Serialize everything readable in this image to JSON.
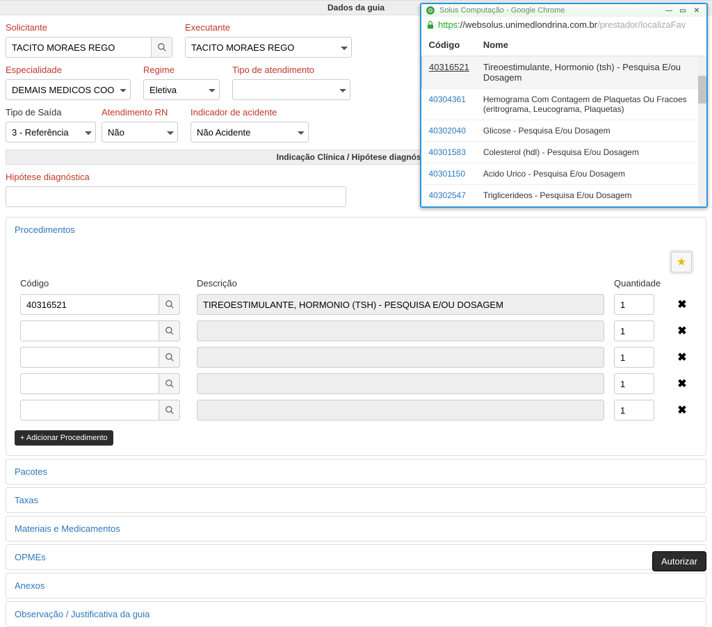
{
  "section1_title": "Dados da guia",
  "fields": {
    "solicitante": {
      "label": "Solicitante",
      "value": "TACITO MORAES REGO"
    },
    "executante": {
      "label": "Executante",
      "value": "TACITO MORAES REGO"
    },
    "especialidade": {
      "label": "Especialidade",
      "value": "DEMAIS MEDICOS COOP"
    },
    "regime": {
      "label": "Regime",
      "value": "Eletiva"
    },
    "tipo_atendimento": {
      "label": "Tipo de atendimento",
      "value": ""
    },
    "tipo_saida": {
      "label": "Tipo de Saída",
      "value": "3 - Referência"
    },
    "atend_rn": {
      "label": "Atendimento RN",
      "value": "Não"
    },
    "ind_acidente": {
      "label": "Indicador de acidente",
      "value": "Não Acidente"
    }
  },
  "section2_title": "Indicação Clínica / Hipótese diagnóstica",
  "hipotese_label": "Hipótese diagnóstica",
  "hipotese_value": "",
  "procedimentos": {
    "tab_label": "Procedimentos",
    "cols": {
      "codigo": "Código",
      "descricao": "Descrição",
      "quantidade": "Quantidade"
    },
    "rows": [
      {
        "codigo": "40316521",
        "descricao": "TIREOESTIMULANTE, HORMONIO (TSH) - PESQUISA E/OU DOSAGEM",
        "quantidade": "1"
      },
      {
        "codigo": "",
        "descricao": "",
        "quantidade": "1"
      },
      {
        "codigo": "",
        "descricao": "",
        "quantidade": "1"
      },
      {
        "codigo": "",
        "descricao": "",
        "quantidade": "1"
      },
      {
        "codigo": "",
        "descricao": "",
        "quantidade": "1"
      }
    ],
    "add_btn": "+ Adicionar Procedimento"
  },
  "accordions": {
    "pacotes": "Pacotes",
    "taxas": "Taxas",
    "materiais": "Materiais e Medicamentos",
    "opmes": "OPMEs",
    "anexos": "Anexos",
    "obs": "Observação / Justificativa da guia"
  },
  "authorize_btn": "Autorizar",
  "popup": {
    "title": "Solus Computação - Google Chrome",
    "url_scheme": "https",
    "url_domain": "://websolus.unimedlondrina.com.br",
    "url_path": "/prestador/localizaFav",
    "th_codigo": "Código",
    "th_nome": "Nome",
    "rows": [
      {
        "codigo": "40316521",
        "nome": "Tireoestimulante, Hormonio (tsh) - Pesquisa E/ou Dosagem",
        "selected": true
      },
      {
        "codigo": "40304361",
        "nome": "Hemograma Com Contagem de Plaquetas Ou Fracoes (eritrograma, Leucograma, Plaquetas)"
      },
      {
        "codigo": "40302040",
        "nome": "Glicose - Pesquisa E/ou Dosagem"
      },
      {
        "codigo": "40301583",
        "nome": "Colesterol (hdl) - Pesquisa E/ou Dosagem"
      },
      {
        "codigo": "40301150",
        "nome": "Acido Urico - Pesquisa E/ou Dosagem"
      },
      {
        "codigo": "40302547",
        "nome": "Triglicerideos - Pesquisa E/ou Dosagem"
      }
    ]
  }
}
